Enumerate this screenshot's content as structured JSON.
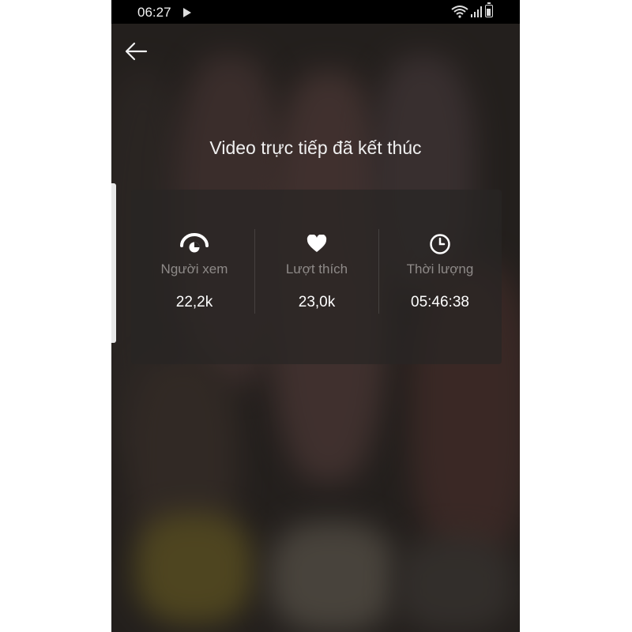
{
  "status_bar": {
    "time": "06:27"
  },
  "screen": {
    "title": "Video trực tiếp đã kết thúc"
  },
  "stats": [
    {
      "icon": "eye-icon",
      "label": "Người xem",
      "value": "22,2k"
    },
    {
      "icon": "heart-icon",
      "label": "Lượt thích",
      "value": "23,0k"
    },
    {
      "icon": "clock-icon",
      "label": "Thời lượng",
      "value": "05:46:38"
    }
  ],
  "colors": {
    "overlay": "#2c2724",
    "label": "#8e8a88",
    "value": "#ffffff"
  }
}
